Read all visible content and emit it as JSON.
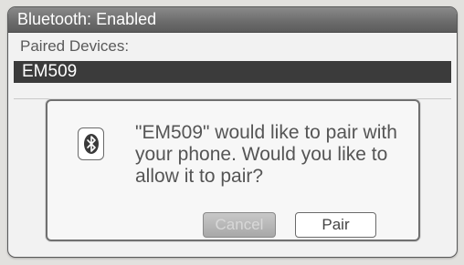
{
  "window": {
    "title": "Bluetooth: Enabled"
  },
  "paired_devices": {
    "label": "Paired Devices:",
    "items": [
      {
        "name": "EM509",
        "selected": true
      }
    ]
  },
  "dialog": {
    "icon": "bluetooth-icon",
    "message": "\"EM509\" would like to pair with your phone. Would you like to allow it to pair?",
    "buttons": {
      "cancel_label": "Cancel",
      "pair_label": "Pair"
    }
  },
  "colors": {
    "titlebar": "#6d6d6d",
    "selection": "#3b3b3b",
    "background": "#f2f2f2"
  }
}
